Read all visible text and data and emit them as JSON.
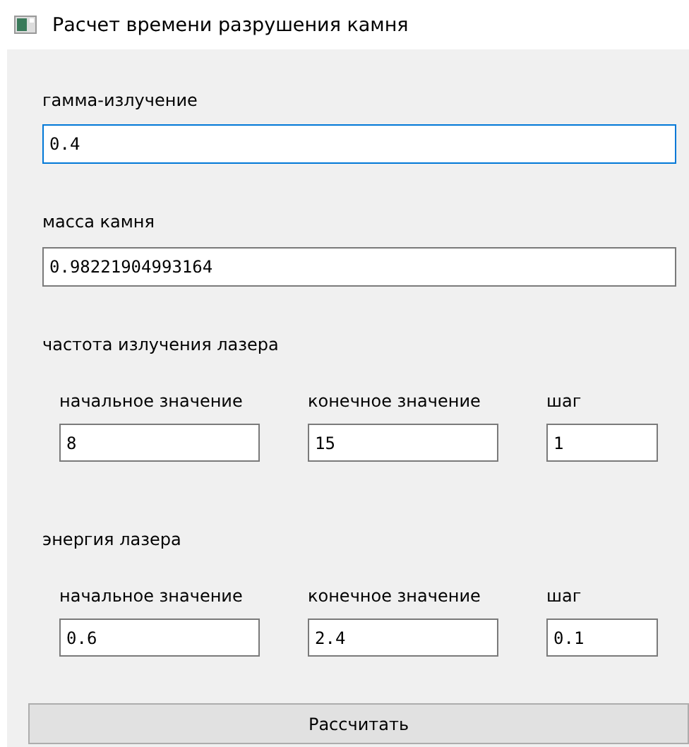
{
  "window": {
    "title": "Расчет времени разрушения камня"
  },
  "gamma": {
    "label": "гамма-излучение",
    "value": "0.4",
    "focused": true
  },
  "mass": {
    "label": "масса камня",
    "value": "0.98221904993164",
    "focused": false
  },
  "ranges": [
    {
      "label": "частота излучения лазера",
      "fields": [
        {
          "label": "начальное значение",
          "value": "8"
        },
        {
          "label": "конечное значение",
          "value": "15"
        },
        {
          "label": "шаг",
          "value": "1"
        }
      ]
    },
    {
      "label": "энергия лазера",
      "fields": [
        {
          "label": "начальное значение",
          "value": "0.6"
        },
        {
          "label": "конечное значение",
          "value": "2.4"
        },
        {
          "label": "шаг",
          "value": "0.1"
        }
      ]
    }
  ],
  "button": "Рассчитать"
}
